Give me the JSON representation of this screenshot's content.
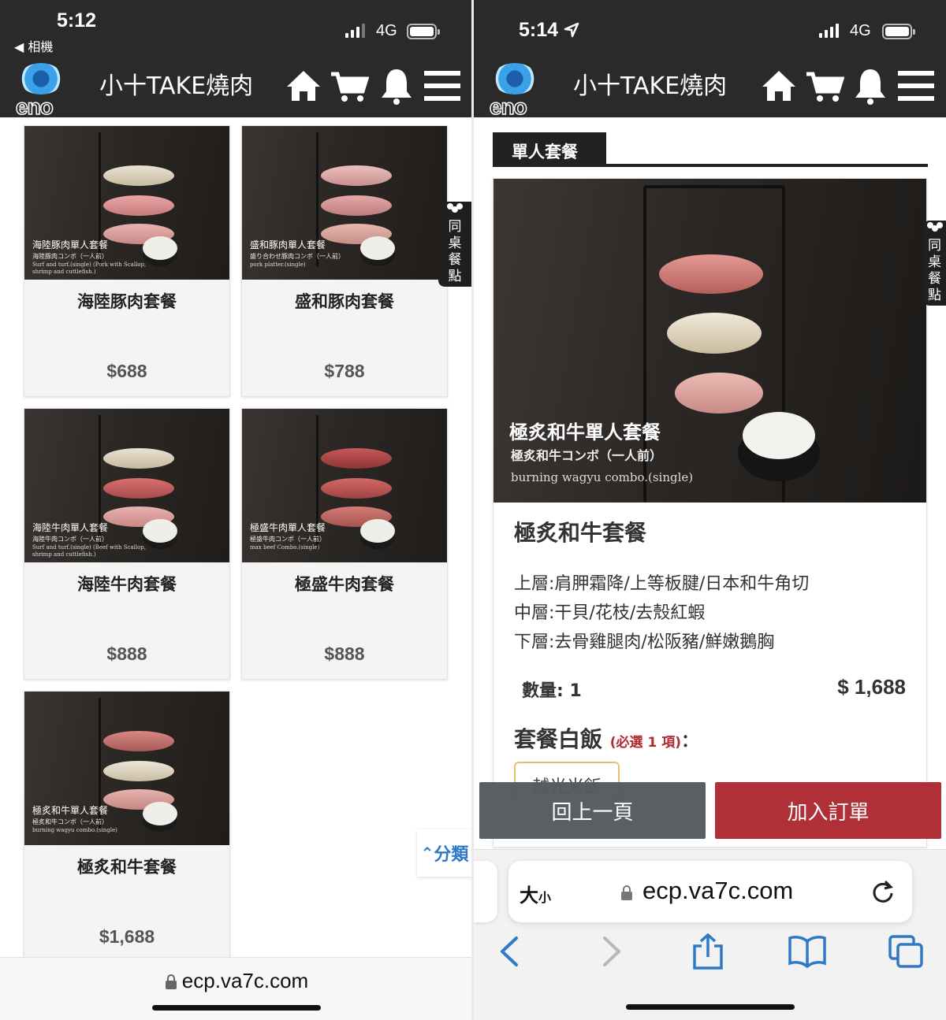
{
  "left": {
    "status": {
      "time": "5:12",
      "back_app": "◀ 相機",
      "network": "4G"
    },
    "header": {
      "logo_text": "eno",
      "shop_title": "小十TAKE燒肉"
    },
    "products": [
      {
        "name": "海陸豚肉套餐",
        "price": "$688",
        "img_title": "海陸豚肉單人套餐",
        "img_sub": "海陸豚肉コンボ（一人前）",
        "img_en": "Surf and turf.(single) (Pork with Scallop, shrimp and cuttlefish.)"
      },
      {
        "name": "盛和豚肉套餐",
        "price": "$788",
        "img_title": "盛和豚肉單人套餐",
        "img_sub": "盛り合わせ豚肉コンボ（一人前）",
        "img_en": "pork platter.(single)"
      },
      {
        "name": "海陸牛肉套餐",
        "price": "$888",
        "img_title": "海陸牛肉單人套餐",
        "img_sub": "海陸牛肉コンボ（一人前）",
        "img_en": "Surf and turf.(single) (Beef with Scallop, shrimp and cuttlefish.)"
      },
      {
        "name": "極盛牛肉套餐",
        "price": "$888",
        "img_title": "極盛牛肉單人套餐",
        "img_sub": "極盛牛肉コンボ（一人前）",
        "img_en": "max beef Combo.(single)"
      },
      {
        "name": "極炙和牛套餐",
        "price": "$1,688",
        "img_title": "極炙和牛單人套餐",
        "img_sub": "極炙和牛コンボ（一人前）",
        "img_en": "burning wagyu combo.(single)"
      }
    ],
    "float_tab": [
      "同",
      "桌",
      "餐",
      "點"
    ],
    "category_button": "分類",
    "url": "ecp.va7c.com"
  },
  "right": {
    "status": {
      "time": "5:14",
      "network": "4G"
    },
    "header": {
      "logo_text": "eno",
      "shop_title": "小十TAKE燒肉"
    },
    "section_tab": "單人套餐",
    "float_tab": [
      "同",
      "桌",
      "餐",
      "點"
    ],
    "photo": {
      "title": "極炙和牛單人套餐",
      "sub": "極炙和牛コンボ（一人前）",
      "en": "burning wagyu combo.(single)"
    },
    "product_name": "極炙和牛套餐",
    "description": {
      "line1": "上層:肩胛霜降/上等板腱/日本和牛角切",
      "line2": "中層:干貝/花枝/去殼紅蝦",
      "line3": "下層:去骨雞腿肉/松阪豬/鮮嫩鵝胸"
    },
    "quantity_label": "數量: 1",
    "price": "$ 1,688",
    "option_group": {
      "title": "套餐白飯",
      "required": "(必選 1 項)",
      "colon": "：",
      "option": "越光米飯"
    },
    "back_button": "回上一頁",
    "add_button": "加入訂單",
    "address_bar": {
      "text_size": "大",
      "text_size_small": "小",
      "url": "ecp.va7c.com"
    }
  },
  "colors": {
    "header_bg": "#2a2a2a",
    "add_button": "#b03038",
    "back_button": "#555a5f",
    "link_blue": "#2f79c7",
    "required_red": "#b02a30",
    "option_border": "#e6c26a"
  }
}
